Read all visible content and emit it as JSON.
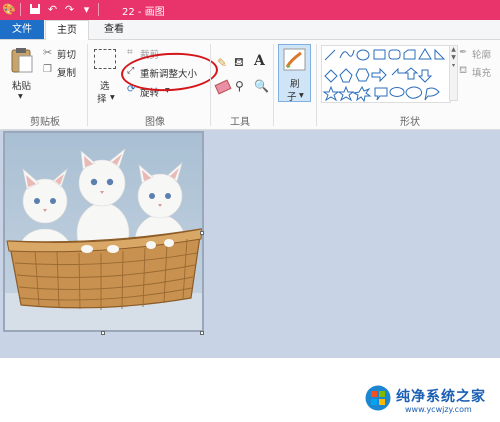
{
  "window": {
    "title": "22 - 画图"
  },
  "tabs": {
    "file": "文件",
    "home": "主页",
    "view": "查看"
  },
  "clipboard": {
    "paste": "粘贴",
    "cut": "剪切",
    "copy": "复制",
    "group_label": "剪贴板"
  },
  "image": {
    "select_line1": "选",
    "select_line2": "择",
    "crop": "裁剪",
    "resize": "重新调整大小",
    "rotate": "旋转",
    "group_label": "图像"
  },
  "tools": {
    "text_tool": "A",
    "group_label": "工具"
  },
  "brushes": {
    "label_line1": "刷",
    "label_line2": "子"
  },
  "shapes": {
    "outline": "轮廓",
    "fill": "填充",
    "group_label": "形状"
  },
  "watermark": {
    "text": "纯净系统之家",
    "url": "www.ycwjzy.com"
  },
  "colors": {
    "titlebar": "#e8336b",
    "file_tab": "#1e6fc8",
    "workspace": "#c9d3e6",
    "annotation": "#d4161b"
  },
  "icons": [
    "paint-app-icon",
    "save-icon",
    "undo-icon",
    "redo-icon",
    "paste-icon",
    "scissors-icon",
    "copy-icon",
    "select-icon",
    "crop-icon",
    "resize-icon",
    "rotate-icon",
    "pencil-icon",
    "fill-bucket-icon",
    "text-icon",
    "eraser-icon",
    "color-picker-icon",
    "magnifier-icon",
    "brush-icon",
    "shapes-gallery-icons",
    "outline-icon",
    "fill-icon",
    "windows-logo-icon"
  ]
}
